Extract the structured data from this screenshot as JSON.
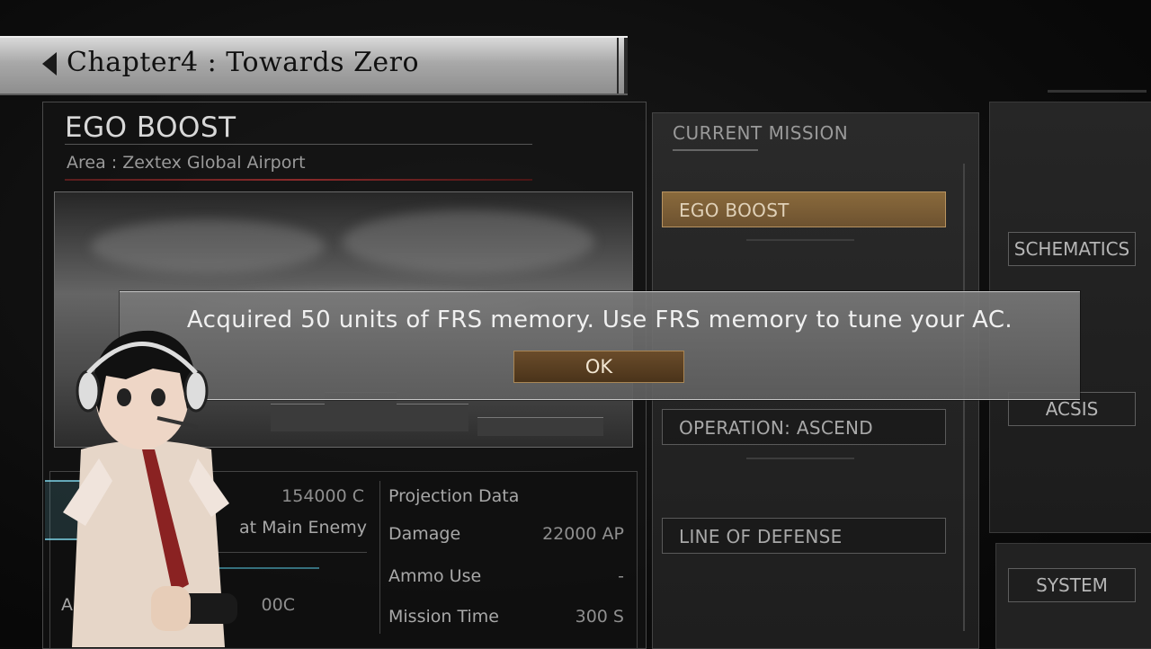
{
  "chapter": {
    "title": "Chapter4 : Towards Zero"
  },
  "mission": {
    "name": "EGO BOOST",
    "area": "Area : Zextex Global Airport",
    "stats_left": [
      {
        "label": "",
        "value": "154000 C"
      },
      {
        "label": "at Main Enemy",
        "value": ""
      },
      {
        "label": "An",
        "value": "00C"
      }
    ],
    "projection": {
      "header": "Projection Data",
      "rows": [
        {
          "label": "Damage",
          "value": "22000 AP"
        },
        {
          "label": "Ammo Use",
          "value": "-"
        },
        {
          "label": "Mission Time",
          "value": "300 S"
        }
      ]
    }
  },
  "current_mission": {
    "header": "CURRENT MISSION",
    "items": [
      {
        "label": "EGO BOOST",
        "selected": true
      },
      {
        "label": "OPERATION: ASCEND",
        "selected": false
      },
      {
        "label": "LINE OF DEFENSE",
        "selected": false
      }
    ]
  },
  "side_menu": {
    "items": [
      {
        "label": "SCHEMATICS"
      },
      {
        "label": "ACSIS"
      },
      {
        "label": "SYSTEM"
      }
    ]
  },
  "dialog": {
    "message": "Acquired 50 units of FRS memory. Use FRS memory to tune your AC.",
    "ok_label": "OK"
  },
  "colors": {
    "accent_selected": "#8a6a3c",
    "dialog_bg": "#6e6e6e",
    "banner_bg": "#b0b0b0"
  }
}
